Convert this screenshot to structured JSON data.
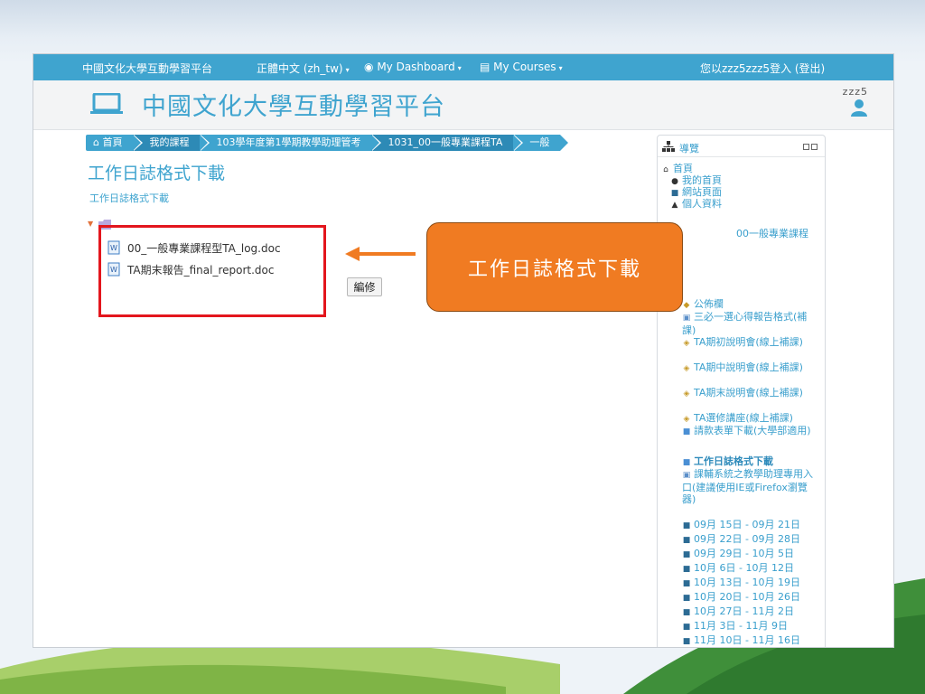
{
  "topbar": {
    "site_name": "中國文化大學互動學習平台",
    "language": "正體中文 (zh_tw)",
    "dashboard": "My Dashboard",
    "courses": "My Courses",
    "login_info": "您以zzz5zzz5登入 (登出)"
  },
  "header": {
    "title": "中國文化大學互動學習平台",
    "user": "zzz5"
  },
  "breadcrumb": [
    "首頁",
    "我的課程",
    "103學年度第1學期教學助理管考",
    "1031_00一般專業課程TA",
    "一般"
  ],
  "page": {
    "title": "工作日誌格式下載",
    "subtitle": "工作日誌格式下載",
    "files": [
      "00_一般專業課程型TA_log.doc",
      "TA期末報告_final_report.doc"
    ],
    "edit_label": "編修"
  },
  "callout": "工作日誌格式下載",
  "nav": {
    "title": "導覽",
    "home": "首頁",
    "items_top": [
      "我的首頁",
      "網站頁面",
      "個人資料"
    ],
    "hidden_partial": "00一般專業課程",
    "forum": "公佈欄",
    "items": [
      "三必一選心得報告格式(補課)",
      "TA期初說明會(線上補課)",
      "TA期中說明會(線上補課)",
      "TA期末說明會(線上補課)",
      "TA選修講座(線上補課)",
      "請款表單下載(大學部適用)",
      "工作日誌格式下載",
      "課輔系統之教學助理專用入口(建議使用IE或Firefox瀏覽器)"
    ],
    "weeks": [
      "09月 15日 - 09月 21日",
      "09月 22日 - 09月 28日",
      "09月 29日 - 10月 5日",
      "10月 6日 - 10月 12日",
      "10月 13日 - 10月 19日",
      "10月 20日 - 10月 26日",
      "10月 27日 - 11月 2日",
      "11月 3日 - 11月 9日",
      "11月 10日 - 11月 16日"
    ]
  },
  "colors": {
    "accent": "#3fa4cf",
    "callout": "#f07b22",
    "highlight": "#e3161d"
  }
}
